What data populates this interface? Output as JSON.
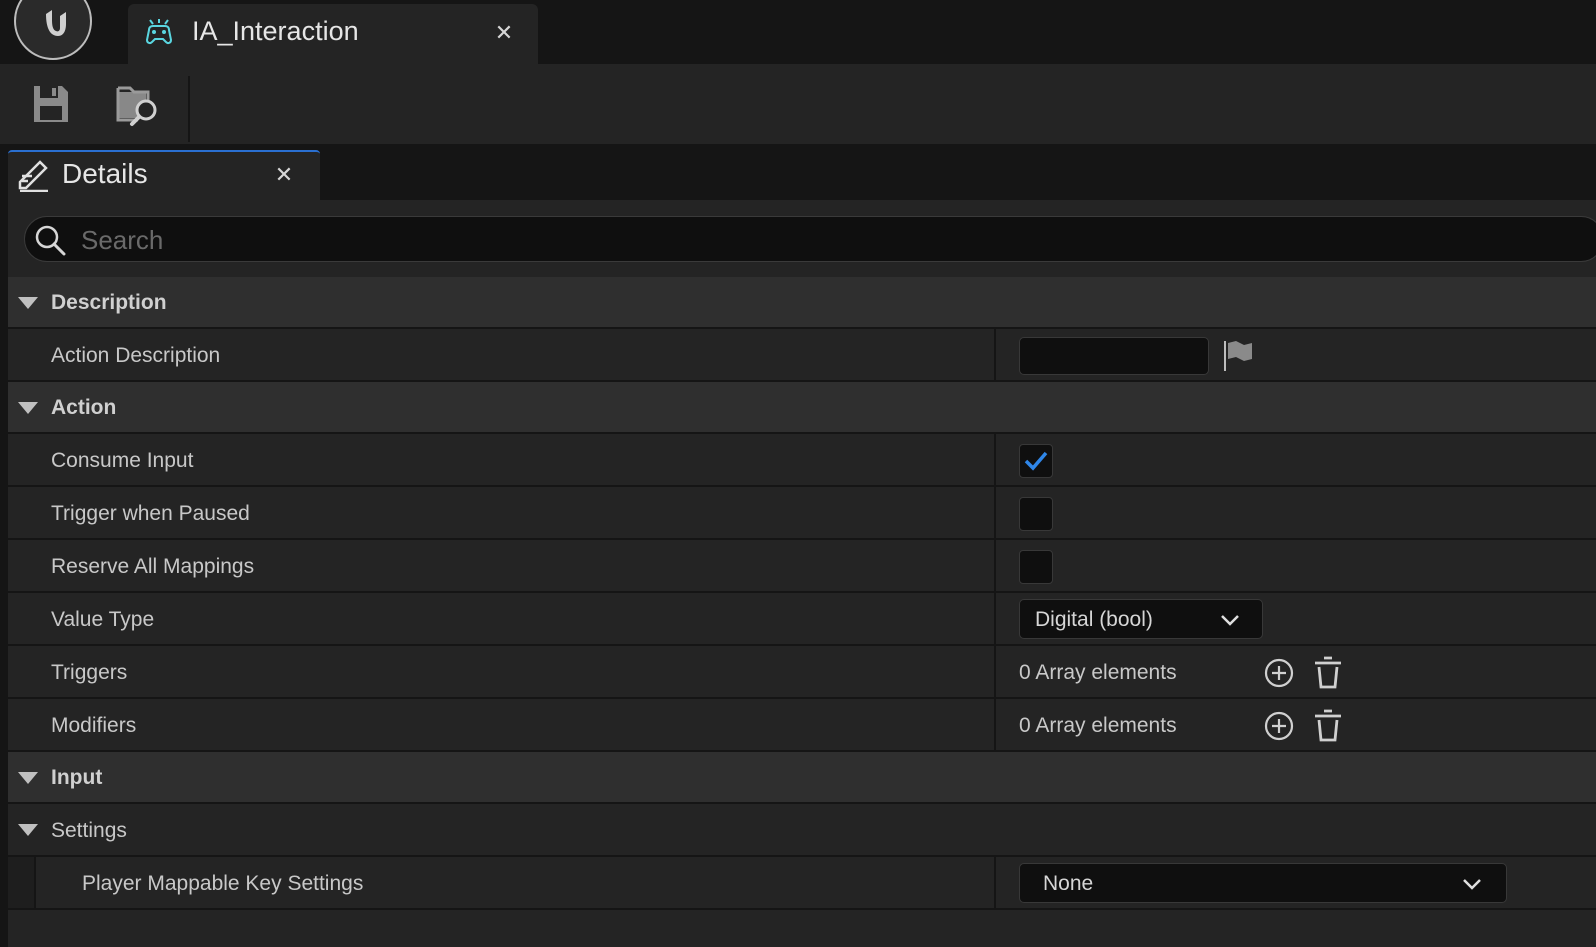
{
  "window": {
    "tab_title": "IA_Interaction"
  },
  "details_tab": {
    "title": "Details"
  },
  "search": {
    "placeholder": "Search"
  },
  "categories": {
    "description": "Description",
    "action": "Action",
    "input": "Input",
    "settings": "Settings"
  },
  "properties": {
    "action_description": {
      "label": "Action Description",
      "value": ""
    },
    "consume_input": {
      "label": "Consume Input",
      "checked": true
    },
    "trigger_when_paused": {
      "label": "Trigger when Paused",
      "checked": false
    },
    "reserve_all_mappings": {
      "label": "Reserve All Mappings",
      "checked": false
    },
    "value_type": {
      "label": "Value Type",
      "value": "Digital (bool)"
    },
    "triggers": {
      "label": "Triggers",
      "value": "0 Array elements"
    },
    "modifiers": {
      "label": "Modifiers",
      "value": "0 Array elements"
    },
    "player_mappable_key_settings": {
      "label": "Player Mappable Key Settings",
      "value": "None"
    }
  },
  "colors": {
    "accent": "#2a6fd0",
    "checkmark": "#2f86e8",
    "asset_icon": "#5ad6e0"
  },
  "icons": {
    "logo": "unreal-logo-icon",
    "asset": "gamepad-icon",
    "save": "save-icon",
    "browse": "browse-folder-icon",
    "details": "pencil-edit-icon",
    "search": "search-icon",
    "flag": "flag-icon",
    "add": "plus-circle-icon",
    "delete": "trash-icon",
    "dropdown": "chevron-down-icon"
  }
}
